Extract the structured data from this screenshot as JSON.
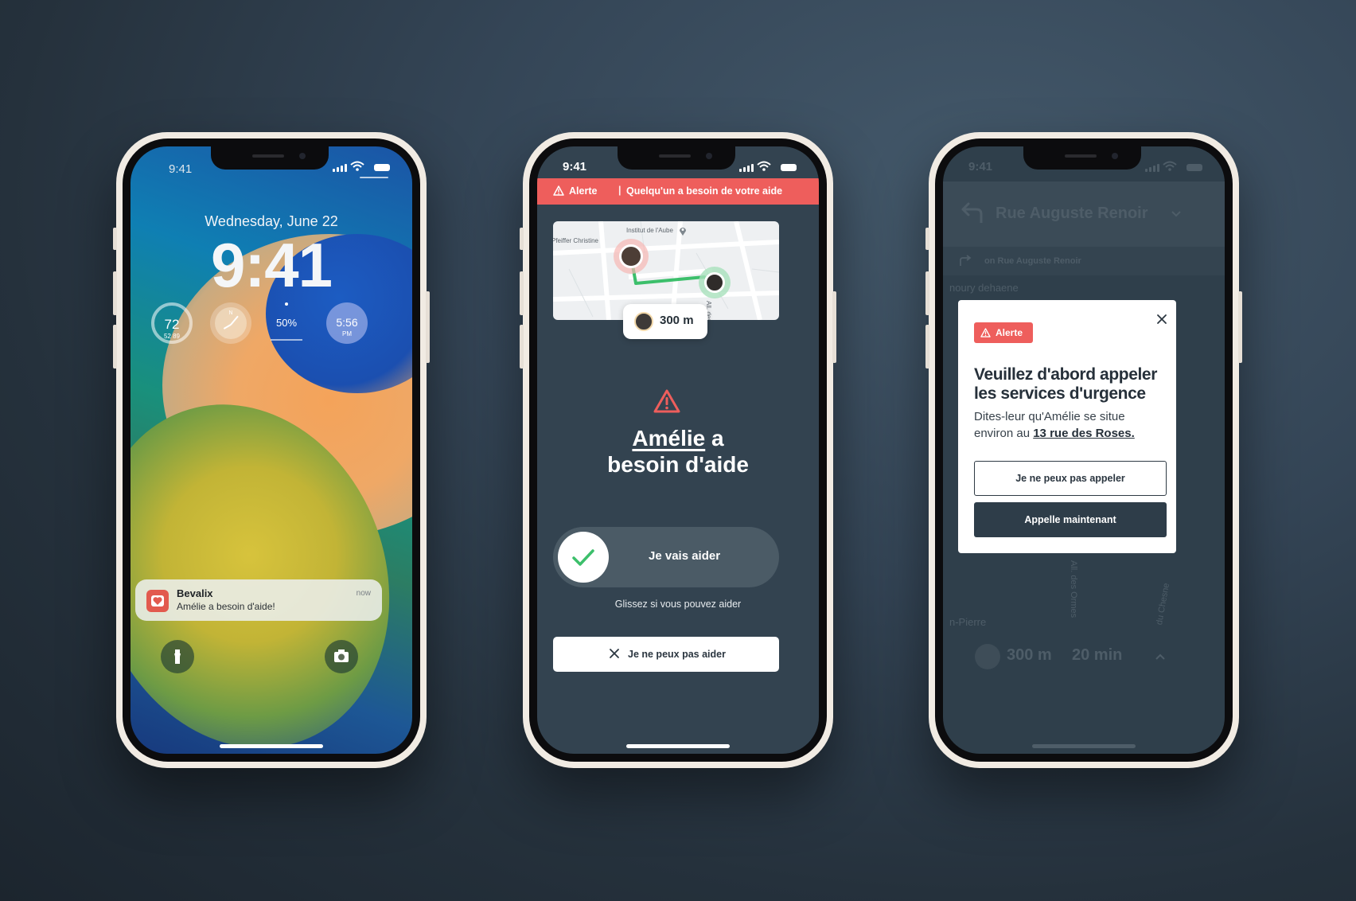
{
  "colors": {
    "alert_red": "#ee5e5c",
    "dark_bg": "#334350",
    "success_green": "#3cbf6b"
  },
  "lockscreen": {
    "status_time": "9:41",
    "date": "Wednesday, June 22",
    "time": "9:41",
    "widgets": {
      "temp": "72",
      "temp_range": "52  89",
      "clock_label": "N",
      "air_pct": "50%",
      "alarm_time": "5:56",
      "alarm_period": "PM"
    },
    "notification": {
      "app": "Bevalix",
      "message": "Amélie a besoin d'aide!",
      "when": "now",
      "icon": "heart-icon"
    },
    "left_button_icon": "flashlight-icon",
    "right_button_icon": "camera-icon"
  },
  "alert_screen": {
    "status_time": "9:41",
    "banner": {
      "label": "Alerte",
      "separator": "|",
      "text": "Quelqu'un a besoin de votre aide"
    },
    "map": {
      "label_1": "Institut de l'Aube",
      "label_2": "Pfeiffer Christine",
      "label_3": "All. des O"
    },
    "distance": "300 m",
    "headline_name": "Amélie",
    "headline_rest": " a",
    "headline_line2": "besoin d'aide",
    "slider_label": "Je vais aider",
    "slider_hint": "Glissez si vous pouvez aider",
    "decline_label": "Je ne peux pas aider"
  },
  "modal_screen": {
    "status_time": "9:41",
    "street": "Rue Auguste Renoir",
    "next_turn": "on Rue Auguste Renoir",
    "bg_labels": {
      "a": "noury dehaene",
      "b": "All. des Ormes",
      "c": "du Chesne",
      "d": "n-Pierre"
    },
    "bottom_distance": "300 m",
    "bottom_eta": "20 min",
    "modal": {
      "chip": "Alerte",
      "title": "Veuillez d'abord appeler les services d'urgence",
      "body_prefix": "Dites-leur qu'Amélie se situe environ au ",
      "address": "13 rue des Roses.",
      "outline_button": "Je ne peux pas appeler",
      "primary_button": "Appelle maintenant"
    }
  }
}
